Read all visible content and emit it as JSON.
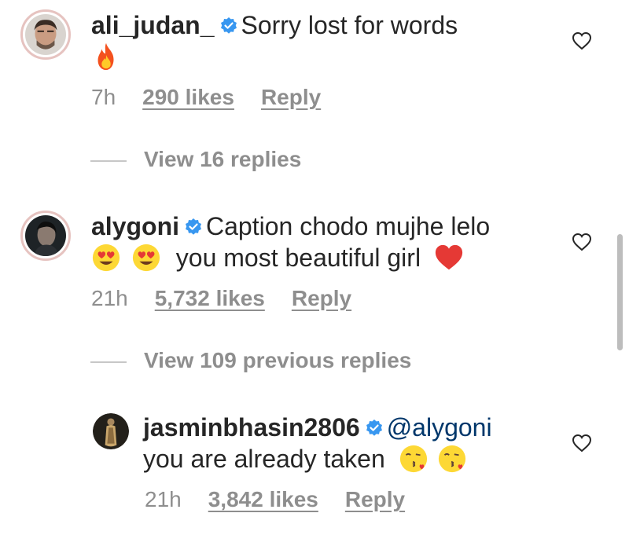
{
  "comments": [
    {
      "username": "ali_judan_",
      "text_line1": "Sorry lost for words",
      "emojis_line2": [
        "fire-emoji"
      ],
      "time": "7h",
      "likes": "290 likes",
      "reply": "Reply"
    },
    {
      "username": "alygoni",
      "text_line1": "Caption chodo mujhe lelo",
      "text_line2": "you most beautiful girl",
      "emojis_line2": [
        "heart-eyes-emoji",
        "heart-eyes-emoji",
        "red-heart-emoji"
      ],
      "time": "21h",
      "likes": "5,732 likes",
      "reply": "Reply"
    },
    {
      "username": "jasminbhasin2806",
      "mention": "@alygoni",
      "text_line2": "you are already taken",
      "emojis_line2": [
        "kissing-heart-emoji",
        "kissing-heart-emoji"
      ],
      "time": "21h",
      "likes": "3,842 likes",
      "reply": "Reply"
    }
  ],
  "view_replies": [
    {
      "label": "View 16 replies"
    },
    {
      "label": "View 109 previous replies"
    }
  ],
  "colors": {
    "text": "#262626",
    "meta": "#8e8e8e",
    "verified": "#3897f0",
    "mention": "#00376b"
  },
  "icons": [
    "verified-badge-icon",
    "heart-outline-icon"
  ]
}
